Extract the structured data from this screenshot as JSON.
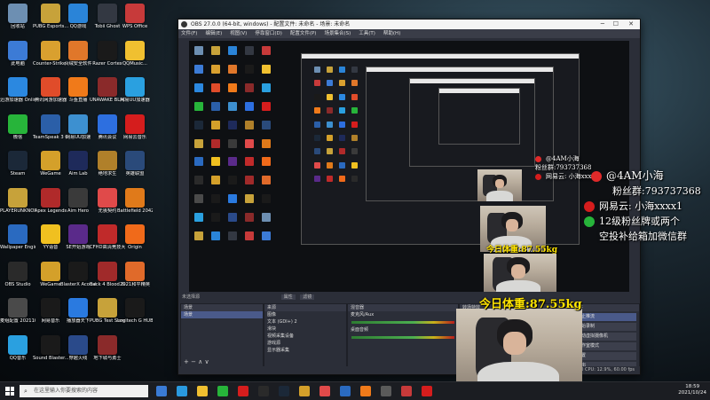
{
  "desktop_icons": [
    {
      "label": "回收站",
      "icon": "recycle-bin-icon",
      "color": "#6d8fb2"
    },
    {
      "label": "PUBG Esports...",
      "icon": "pubg-icon",
      "color": "#c7a23a"
    },
    {
      "label": "QQ游戏",
      "icon": "qq-game-icon",
      "color": "#2a84d8"
    },
    {
      "label": "Tobii Ghost",
      "icon": "tobii-icon",
      "color": "#333842"
    },
    {
      "label": "WPS Office",
      "icon": "wps-icon",
      "color": "#c73a3a"
    },
    {
      "label": "此电脑",
      "icon": "this-pc-icon",
      "color": "#3c7bd6"
    },
    {
      "label": "Counter-Strike Global Offe...",
      "icon": "csgo-icon",
      "color": "#d9a02f"
    },
    {
      "label": "火绒安全软件",
      "icon": "huorong-icon",
      "color": "#e0772a"
    },
    {
      "label": "Razer Cortex",
      "icon": "razer-icon",
      "color": "#1a1a1a"
    },
    {
      "label": "QQMusic...",
      "icon": "qqmusic-icon",
      "color": "#f0c030"
    },
    {
      "label": "迅游加速器 Online",
      "icon": "xunyou-icon",
      "color": "#2b88e0"
    },
    {
      "label": "腾讯网游加速器",
      "icon": "tx-accel-icon",
      "color": "#e04c2a"
    },
    {
      "label": "斗鱼直播",
      "icon": "douyu-icon",
      "color": "#f07a1a"
    },
    {
      "label": "UNAWAKE BLADEPOI...",
      "icon": "game-icon",
      "color": "#8a2a2a"
    },
    {
      "label": "网易UU加速器",
      "icon": "uu-icon",
      "color": "#2aa0e0"
    },
    {
      "label": "微信",
      "icon": "wechat-icon",
      "color": "#27b43a"
    },
    {
      "label": "TeamSpeak 3 Client",
      "icon": "teamspeak-icon",
      "color": "#2b5fa8"
    },
    {
      "label": "网易UU加速",
      "icon": "uu2-icon",
      "color": "#3d90d0"
    },
    {
      "label": "腾讯会议",
      "icon": "tx-meeting-icon",
      "color": "#2d6fe0"
    },
    {
      "label": "网易云音乐",
      "icon": "netease-music-icon",
      "color": "#d51d1d"
    },
    {
      "label": "Steam",
      "icon": "steam-icon",
      "color": "#1b2838"
    },
    {
      "label": "WeGame",
      "icon": "wegame-icon",
      "color": "#d4a02a"
    },
    {
      "label": "Aim Lab",
      "icon": "aimlab-icon",
      "color": "#1e2a5a"
    },
    {
      "label": "绝地求生",
      "icon": "pubg2-icon",
      "color": "#b0802a"
    },
    {
      "label": "英雄联盟",
      "icon": "lol-icon",
      "color": "#2a4a7a"
    },
    {
      "label": "PLAYERUNKNOWN BATTLEGR...",
      "icon": "pubg3-icon",
      "color": "#c7a23a"
    },
    {
      "label": "Apex Legends",
      "icon": "apex-icon",
      "color": "#b02a2a"
    },
    {
      "label": "Aim Hero",
      "icon": "aimhero-icon",
      "color": "#3a3a3a"
    },
    {
      "label": "无畏契约",
      "icon": "valorant-icon",
      "color": "#e04a4a"
    },
    {
      "label": "Battlefield 2042 Open",
      "icon": "bf-icon",
      "color": "#e07a1a"
    },
    {
      "label": "Wallpaper Engine",
      "icon": "wallpaper-icon",
      "color": "#2a6ac0"
    },
    {
      "label": "YY语音",
      "icon": "yy-icon",
      "color": "#f0c020"
    },
    {
      "label": "SE开始游戏",
      "icon": "se-icon",
      "color": "#5a2a8a"
    },
    {
      "label": "CFHD高清竞技大区",
      "icon": "cfhd-icon",
      "color": "#c02a2a"
    },
    {
      "label": "Origin",
      "icon": "origin-icon",
      "color": "#f06a1a"
    },
    {
      "label": "OBS Studio",
      "icon": "obs-icon",
      "color": "#2a2a2a"
    },
    {
      "label": "WeGame",
      "icon": "wegame2-icon",
      "color": "#d4a02a"
    },
    {
      "label": "BlasterX Acoustic...",
      "icon": "blasterx-icon",
      "color": "#1a1a1a"
    },
    {
      "label": "Back 4 Blood Beta",
      "icon": "b4b-icon",
      "color": "#a02a2a"
    },
    {
      "label": "2021和平精英",
      "icon": "pubgm-icon",
      "color": "#e06a2a"
    },
    {
      "label": "麦组配置 20211031...",
      "icon": "file-icon",
      "color": "#4a4a4a"
    },
    {
      "label": "网易音乐",
      "icon": "netease2-icon",
      "color": "#1a1a1a"
    },
    {
      "label": "播放器天下",
      "icon": "player-icon",
      "color": "#2a7ae0"
    },
    {
      "label": "PUBG Test Server",
      "icon": "pubg-test-icon",
      "color": "#c7a23a"
    },
    {
      "label": "Logitech G HUB",
      "icon": "ghub-icon",
      "color": "#1a1a1a"
    },
    {
      "label": "QQ音乐",
      "icon": "qqmusic2-icon",
      "color": "#2aa0e0"
    },
    {
      "label": "Sound Blaster...",
      "icon": "soundblaster-icon",
      "color": "#1a1a1a"
    },
    {
      "label": "穿越火线",
      "icon": "cf-icon",
      "color": "#2a4a8a"
    },
    {
      "label": "地下城与勇士",
      "icon": "dnf-icon",
      "color": "#8a2a2a"
    }
  ],
  "obs": {
    "title": "OBS 27.0.0 (64-bit, windows) - 配置文件: 未命名 - 场景: 未命名",
    "menu": [
      "文件(F)",
      "编辑(E)",
      "视图(V)",
      "停靠窗口(D)",
      "配置文件(P)",
      "场景集合(S)",
      "工具(T)",
      "帮助(H)"
    ],
    "filter_label": "未选择源",
    "props_label": "属性",
    "filters_btn": "滤镜",
    "scenes_header": "场景",
    "sources_header": "来源",
    "mixer_header": "混音器",
    "transition_header": "转场特效",
    "controls_header": "控件",
    "scene_item": "场景",
    "sources": [
      "图像",
      "文本 (GDI+) 2",
      "滑块",
      "视频采集设备",
      "游戏源",
      "显示器采集"
    ],
    "mixer": [
      {
        "name": "麦克风/Aux",
        "level": "0.0 dB"
      },
      {
        "name": "桌面音频",
        "level": "0.0 dB"
      }
    ],
    "controls": [
      "停止推流",
      "开始录制",
      "启动虚拟摄像机",
      "工作室模式",
      "设置",
      "退出"
    ],
    "status": "LIVE: 00:00:00  REC: 00:00:00  CPU: 12.9%, 60.00 fps"
  },
  "overlay": {
    "weight_text": "今日体重:87.55kg",
    "handle": "@4AM小海",
    "fans_group": "粉丝群:793737368",
    "netease": "网易云: 小海xxxx1",
    "promo_line1": "12级粉丝牌或两个",
    "promo_line2": "空投补给箱加微信群"
  },
  "taskbar": {
    "search_placeholder": "在这里输入你要搜索的内容",
    "time": "18:59",
    "date": "2021/10/24"
  }
}
